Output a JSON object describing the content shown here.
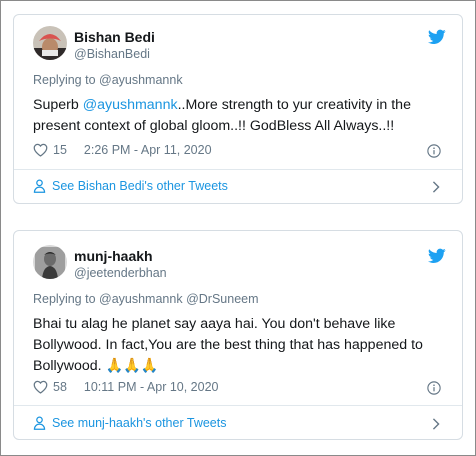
{
  "tweets": [
    {
      "name": "Bishan Bedi",
      "handle": "@BishanBedi",
      "replying_prefix": "Replying to ",
      "replying_to": "@ayushmannk",
      "replying_to_2": "",
      "body_mention": "@ayushmannk",
      "body_line1_prefix": "Superb ",
      "body_line1_suffix": "..More strength to yur creativity in the",
      "body_line2": "present context of global gloom..!! GodBless All Always..!!",
      "likes": "15",
      "datetime": "2:26 PM - Apr 11, 2020",
      "other_tweets": "See Bishan Bedi's other Tweets"
    },
    {
      "name": "munj-haakh",
      "handle": "@jeetenderbhan",
      "replying_prefix": "Replying to ",
      "replying_to": "@ayushmannk",
      "replying_to_2": "@DrSuneem",
      "body_line1": "Bhai tu alag he planet say aaya hai. You don't behave like",
      "body_line2": "Bollywood. In fact,You are the best thing that has happened to",
      "body_line3": "Bollywood. ",
      "emoji": "🙏🙏🙏",
      "likes": "58",
      "datetime": "10:11 PM - Apr 10, 2020",
      "other_tweets": "See munj-haakh's other Tweets"
    }
  ],
  "colors": {
    "link": "#1b95e0",
    "secondary_text": "#657786",
    "primary_text": "#14171a",
    "border": "#d6dde3",
    "twitter_bird": "#1da1f2"
  },
  "icons": [
    "twitter-bird-icon",
    "heart-icon",
    "info-icon",
    "person-icon",
    "chevron-right-icon"
  ]
}
